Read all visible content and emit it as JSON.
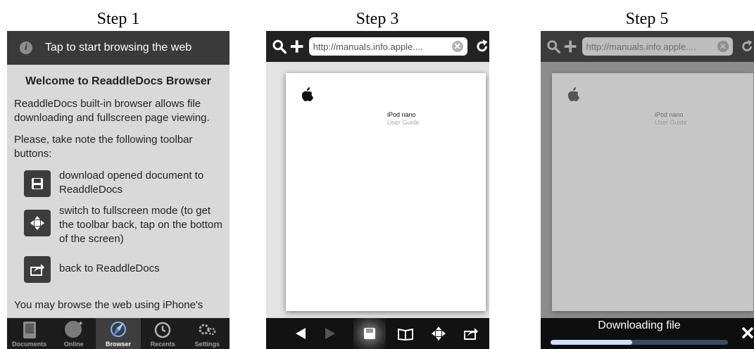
{
  "steps": {
    "s1": "Step 1",
    "s3": "Step 3",
    "s5": "Step 5"
  },
  "step1": {
    "header_text": "Tap to start browsing the web",
    "welcome": "Welcome to ReaddleDocs Browser",
    "para1": "ReaddleDocs built-in browser allows file downloading and fullscreen page viewing.",
    "para2": "Please, take note the following toolbar buttons:",
    "items": [
      {
        "text": "download opened document to ReaddleDocs",
        "icon": "save-icon"
      },
      {
        "text": "switch to fullscreen mode (to get the toolbar back, tap on the bottom of the screen)",
        "icon": "fullscreen-arrows-icon"
      },
      {
        "text": "back to ReaddleDocs",
        "icon": "share-arrow-icon"
      }
    ],
    "para3": "You may browse the web using iPhone's",
    "tabs": [
      {
        "label": "Documents"
      },
      {
        "label": "Online"
      },
      {
        "label": "Browser"
      },
      {
        "label": "Recents"
      },
      {
        "label": "Settings"
      }
    ],
    "active_tab": "Browser"
  },
  "step3": {
    "url": "http://manuals.info.apple....",
    "doc_title": "iPod nano",
    "doc_subtitle": "User Guide"
  },
  "step5": {
    "url": "http://manuals.info.apple....",
    "doc_title": "iPod nano",
    "doc_subtitle": "User Guide",
    "download_text": "Downloading file",
    "progress": 0.46
  },
  "colors": {
    "header_dark": "#3a3a3a",
    "panel_gray": "#d9d9d9",
    "progress_fill": "#cfe0ff"
  }
}
